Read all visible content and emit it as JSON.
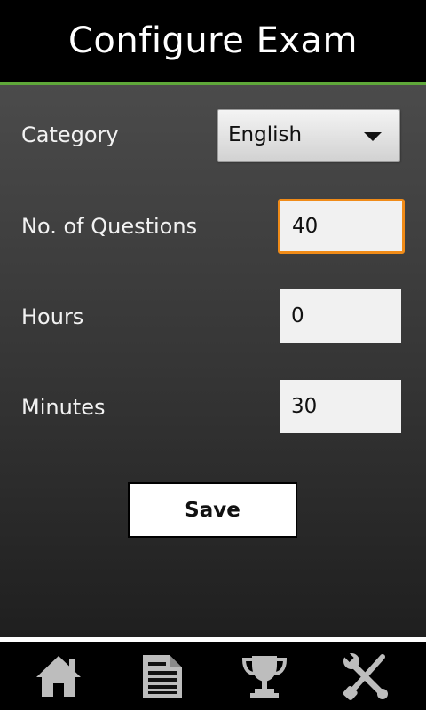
{
  "header": {
    "title": "Configure Exam"
  },
  "form": {
    "category": {
      "label": "Category",
      "value": "English"
    },
    "questions": {
      "label": "No. of Questions",
      "value": "40"
    },
    "hours": {
      "label": "Hours",
      "value": "0"
    },
    "minutes": {
      "label": "Minutes",
      "value": "30"
    },
    "save_label": "Save"
  },
  "nav": {
    "items": [
      {
        "icon": "home-icon"
      },
      {
        "icon": "document-icon"
      },
      {
        "icon": "trophy-icon"
      },
      {
        "icon": "tools-icon"
      }
    ]
  },
  "colors": {
    "accent": "#5fa83a",
    "focus": "#f08b18",
    "icon": "#bdbdbd"
  }
}
